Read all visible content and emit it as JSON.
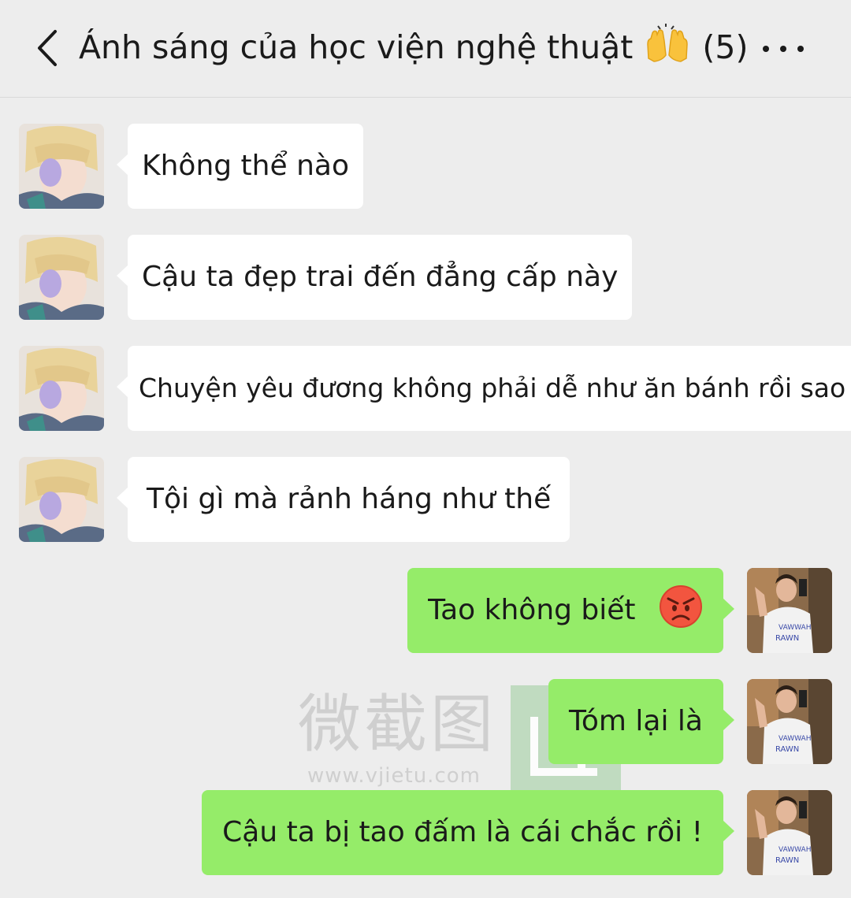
{
  "header": {
    "title": "Ánh sáng của học viện nghệ thuật",
    "title_emoji": "raising-hands-emoji",
    "member_count": "(5)",
    "back_icon": "chevron-left-icon",
    "more_icon": "more-dots-icon"
  },
  "watermark": {
    "text": "微截图",
    "url": "www.vjietu.com"
  },
  "messages": [
    {
      "side": "left",
      "text": "Không thể nào"
    },
    {
      "side": "left",
      "text": "Cậu ta đẹp trai đến đẳng cấp này"
    },
    {
      "side": "left",
      "text": "Chuyện yêu đương không phải dễ như ăn bánh rồi sao"
    },
    {
      "side": "left",
      "text": "Tội gì mà rảnh háng như thế"
    },
    {
      "side": "right",
      "text": "Tao không biết",
      "emoji": "angry-face-emoji"
    },
    {
      "side": "right",
      "text": "Tóm lại là"
    },
    {
      "side": "right",
      "text": "Cậu ta bị tao đấm là cái chắc rồi !"
    }
  ],
  "colors": {
    "background": "#ededed",
    "incoming_bubble": "#ffffff",
    "outgoing_bubble": "#95ec69",
    "text": "#1a1a1a"
  }
}
